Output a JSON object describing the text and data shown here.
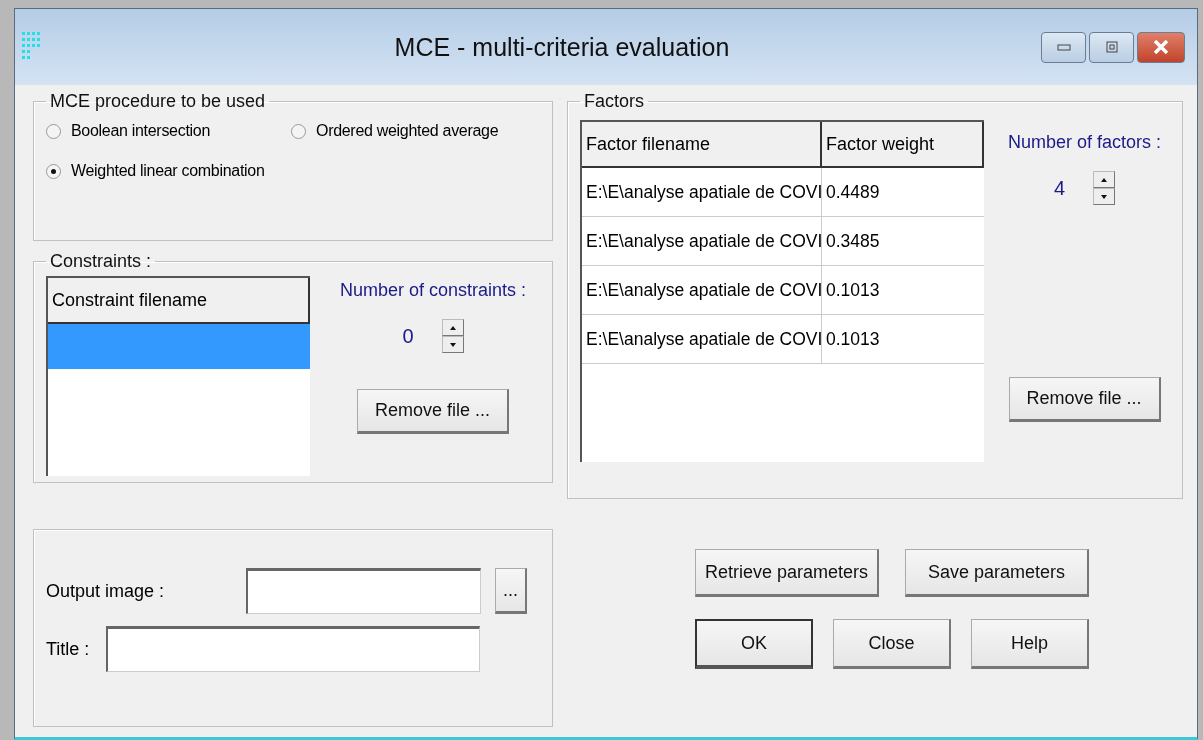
{
  "window": {
    "title": "MCE - multi-criteria evaluation"
  },
  "procedure": {
    "legend": "MCE procedure to be used",
    "options": [
      {
        "label": "Boolean intersection",
        "selected": false
      },
      {
        "label": "Ordered weighted average",
        "selected": false
      },
      {
        "label": "Weighted linear combination",
        "selected": true
      }
    ]
  },
  "constraints": {
    "legend": "Constraints :",
    "column": "Constraint filename",
    "rows": [
      {
        "selected": true
      }
    ],
    "count_label": "Number of constraints :",
    "count": "0",
    "remove_button": "Remove file ..."
  },
  "factors": {
    "legend": "Factors",
    "columns": [
      "Factor filename",
      "Factor weight"
    ],
    "rows": [
      {
        "filename": "E:\\E\\analyse apatiale de COVI",
        "weight": "0.4489"
      },
      {
        "filename": "E:\\E\\analyse apatiale de COVI",
        "weight": "0.3485"
      },
      {
        "filename": "E:\\E\\analyse apatiale de COVI",
        "weight": "0.1013"
      },
      {
        "filename": "E:\\E\\analyse apatiale de COVI",
        "weight": "0.1013"
      }
    ],
    "count_label": "Number of factors :",
    "count": "4",
    "remove_button": "Remove file ..."
  },
  "output": {
    "image_label": "Output image :",
    "browse_button": "...",
    "title_label": "Title :"
  },
  "buttons": {
    "retrieve": "Retrieve parameters",
    "save": "Save parameters",
    "ok": "OK",
    "close": "Close",
    "help": "Help"
  }
}
